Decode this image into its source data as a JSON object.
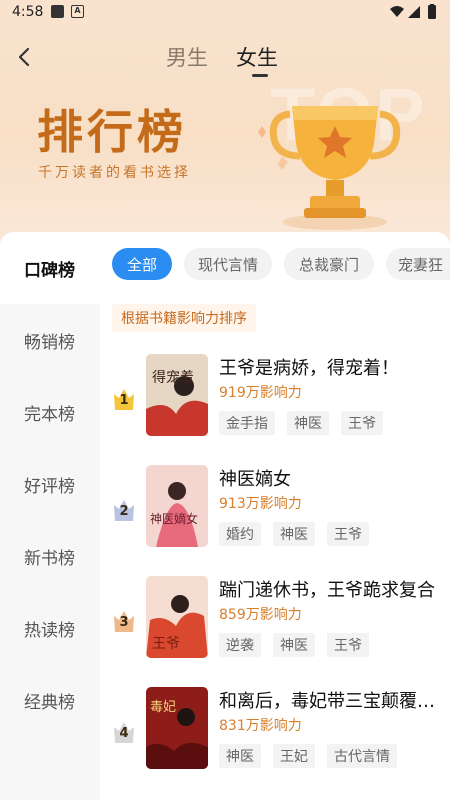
{
  "status_bar": {
    "time": "4:58",
    "icon2": "A",
    "icons": [
      "photo-icon",
      "a-icon",
      "wifi-icon",
      "signal-icon",
      "battery-icon"
    ]
  },
  "header": {
    "back_icon": "chevron-left-icon",
    "tabs": [
      {
        "label": "男生"
      },
      {
        "label": "女生"
      }
    ],
    "active_tab": "女生"
  },
  "hero": {
    "title": "排行榜",
    "subtitle": "千万读者的看书选择",
    "watermark": "TOP",
    "trophy_icon": "trophy-icon"
  },
  "sidebar": {
    "items": [
      {
        "label": "口碑榜"
      },
      {
        "label": "畅销榜"
      },
      {
        "label": "完本榜"
      },
      {
        "label": "好评榜"
      },
      {
        "label": "新书榜"
      },
      {
        "label": "热读榜"
      },
      {
        "label": "经典榜"
      }
    ],
    "active": "口碑榜"
  },
  "categories": {
    "chips": [
      {
        "label": "全部"
      },
      {
        "label": "现代言情"
      },
      {
        "label": "总裁豪门"
      },
      {
        "label": "宠妻狂"
      }
    ],
    "active": "全部"
  },
  "sort_label": "根据书籍影响力排序",
  "books": [
    {
      "rank": "1",
      "title": "王爷是病娇，得宠着！",
      "score": "919万影响力",
      "tags": [
        "金手指",
        "神医",
        "王爷"
      ],
      "cover_text": "得宠着",
      "crown_color": "#f5c53a"
    },
    {
      "rank": "2",
      "title": "神医嫡女",
      "score": "913万影响力",
      "tags": [
        "婚约",
        "神医",
        "王爷"
      ],
      "cover_text": "神医嫡女",
      "crown_color": "#b9c2e3"
    },
    {
      "rank": "3",
      "title": "踹门递休书，王爷跪求复合",
      "score": "859万影响力",
      "tags": [
        "逆袭",
        "神医",
        "王爷"
      ],
      "cover_text": "王爷",
      "crown_color": "#f0b98c"
    },
    {
      "rank": "4",
      "title": "和离后，毒妃带三宝颠覆江山",
      "score": "831万影响力",
      "tags": [
        "神医",
        "王妃",
        "古代言情"
      ],
      "cover_text": "毒妃",
      "crown_color": "#d6d6d6"
    }
  ],
  "colors": {
    "accent": "#2b8cf2",
    "score": "#d97e2a",
    "title": "#c46b1a"
  }
}
